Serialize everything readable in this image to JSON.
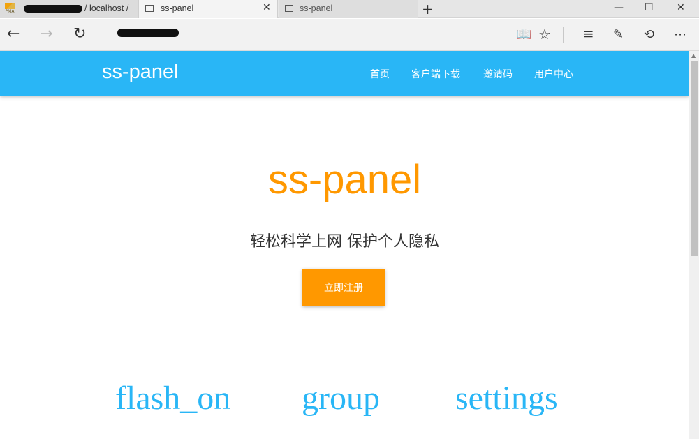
{
  "browser": {
    "tabs": [
      {
        "label": "/ localhost /",
        "active": false
      },
      {
        "label": "ss-panel",
        "active": true
      },
      {
        "label": "ss-panel",
        "active": false
      }
    ],
    "pma_logo_text": "PMA",
    "new_tab_glyph": "+",
    "window_controls": {
      "minimize": "—",
      "maximize": "☐",
      "close": "✕"
    },
    "nav_icons": {
      "back": "←",
      "forward": "→",
      "refresh": "↻"
    },
    "toolbar_icons": {
      "reading_view": "📖",
      "favorite": "☆",
      "hub": "≡",
      "web_note": "✎",
      "share": "⟲",
      "more": "⋯"
    }
  },
  "navbar": {
    "brand": "ss-panel",
    "links": [
      "首页",
      "客户端下载",
      "邀请码",
      "用户中心"
    ]
  },
  "hero": {
    "title": "ss-panel",
    "subtitle": "轻松科学上网 保护个人隐私",
    "cta_label": "立即注册"
  },
  "features": [
    {
      "icon_text": "flash_on"
    },
    {
      "icon_text": "group"
    },
    {
      "icon_text": "settings"
    }
  ],
  "colors": {
    "primary": "#29b6f6",
    "accent": "#ff9800",
    "text": "#333333"
  }
}
